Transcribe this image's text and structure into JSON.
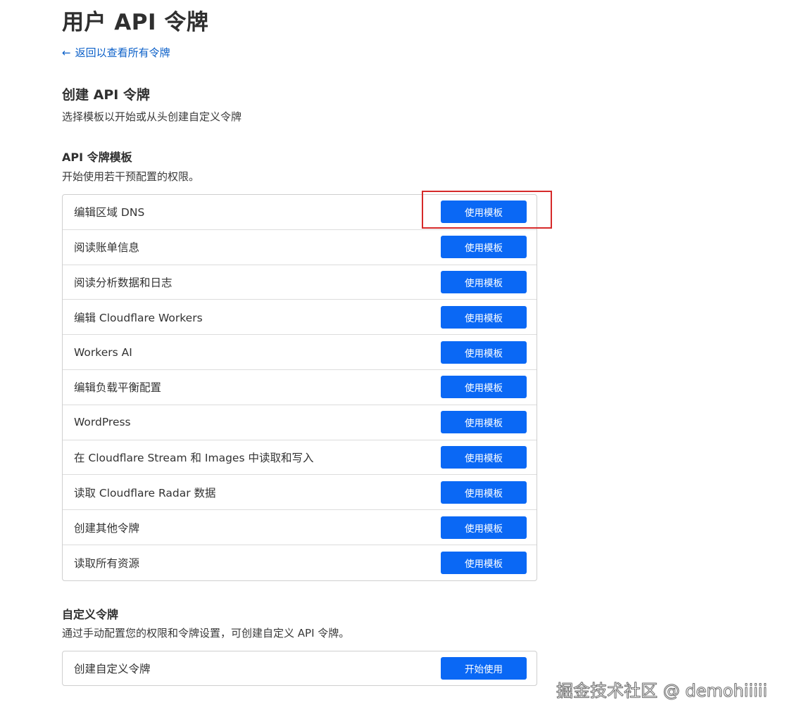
{
  "header": {
    "title": "用户 API 令牌",
    "back_arrow": "←",
    "back_link": "返回以查看所有令牌"
  },
  "create": {
    "title": "创建 API 令牌",
    "subtitle": "选择模板以开始或从头创建自定义令牌"
  },
  "templates": {
    "title": "API 令牌模板",
    "subtitle": "开始使用若干预配置的权限。",
    "button_label": "使用模板",
    "items": [
      {
        "label": "编辑区域 DNS"
      },
      {
        "label": "阅读账单信息"
      },
      {
        "label": "阅读分析数据和日志"
      },
      {
        "label": "编辑 Cloudflare Workers"
      },
      {
        "label": "Workers AI"
      },
      {
        "label": "编辑负载平衡配置"
      },
      {
        "label": "WordPress"
      },
      {
        "label": "在 Cloudflare Stream 和 Images 中读取和写入"
      },
      {
        "label": "读取 Cloudflare Radar 数据"
      },
      {
        "label": "创建其他令牌"
      },
      {
        "label": "读取所有资源"
      }
    ]
  },
  "custom": {
    "title": "自定义令牌",
    "subtitle": "通过手动配置您的权限和令牌设置，可创建自定义 API 令牌。",
    "row_label": "创建自定义令牌",
    "button_label": "开始使用"
  },
  "watermark": "掘金技术社区 @ demohiiiii",
  "colors": {
    "accent": "#0a68f5",
    "link": "#0a5fc8",
    "highlight": "#d62a2a"
  }
}
